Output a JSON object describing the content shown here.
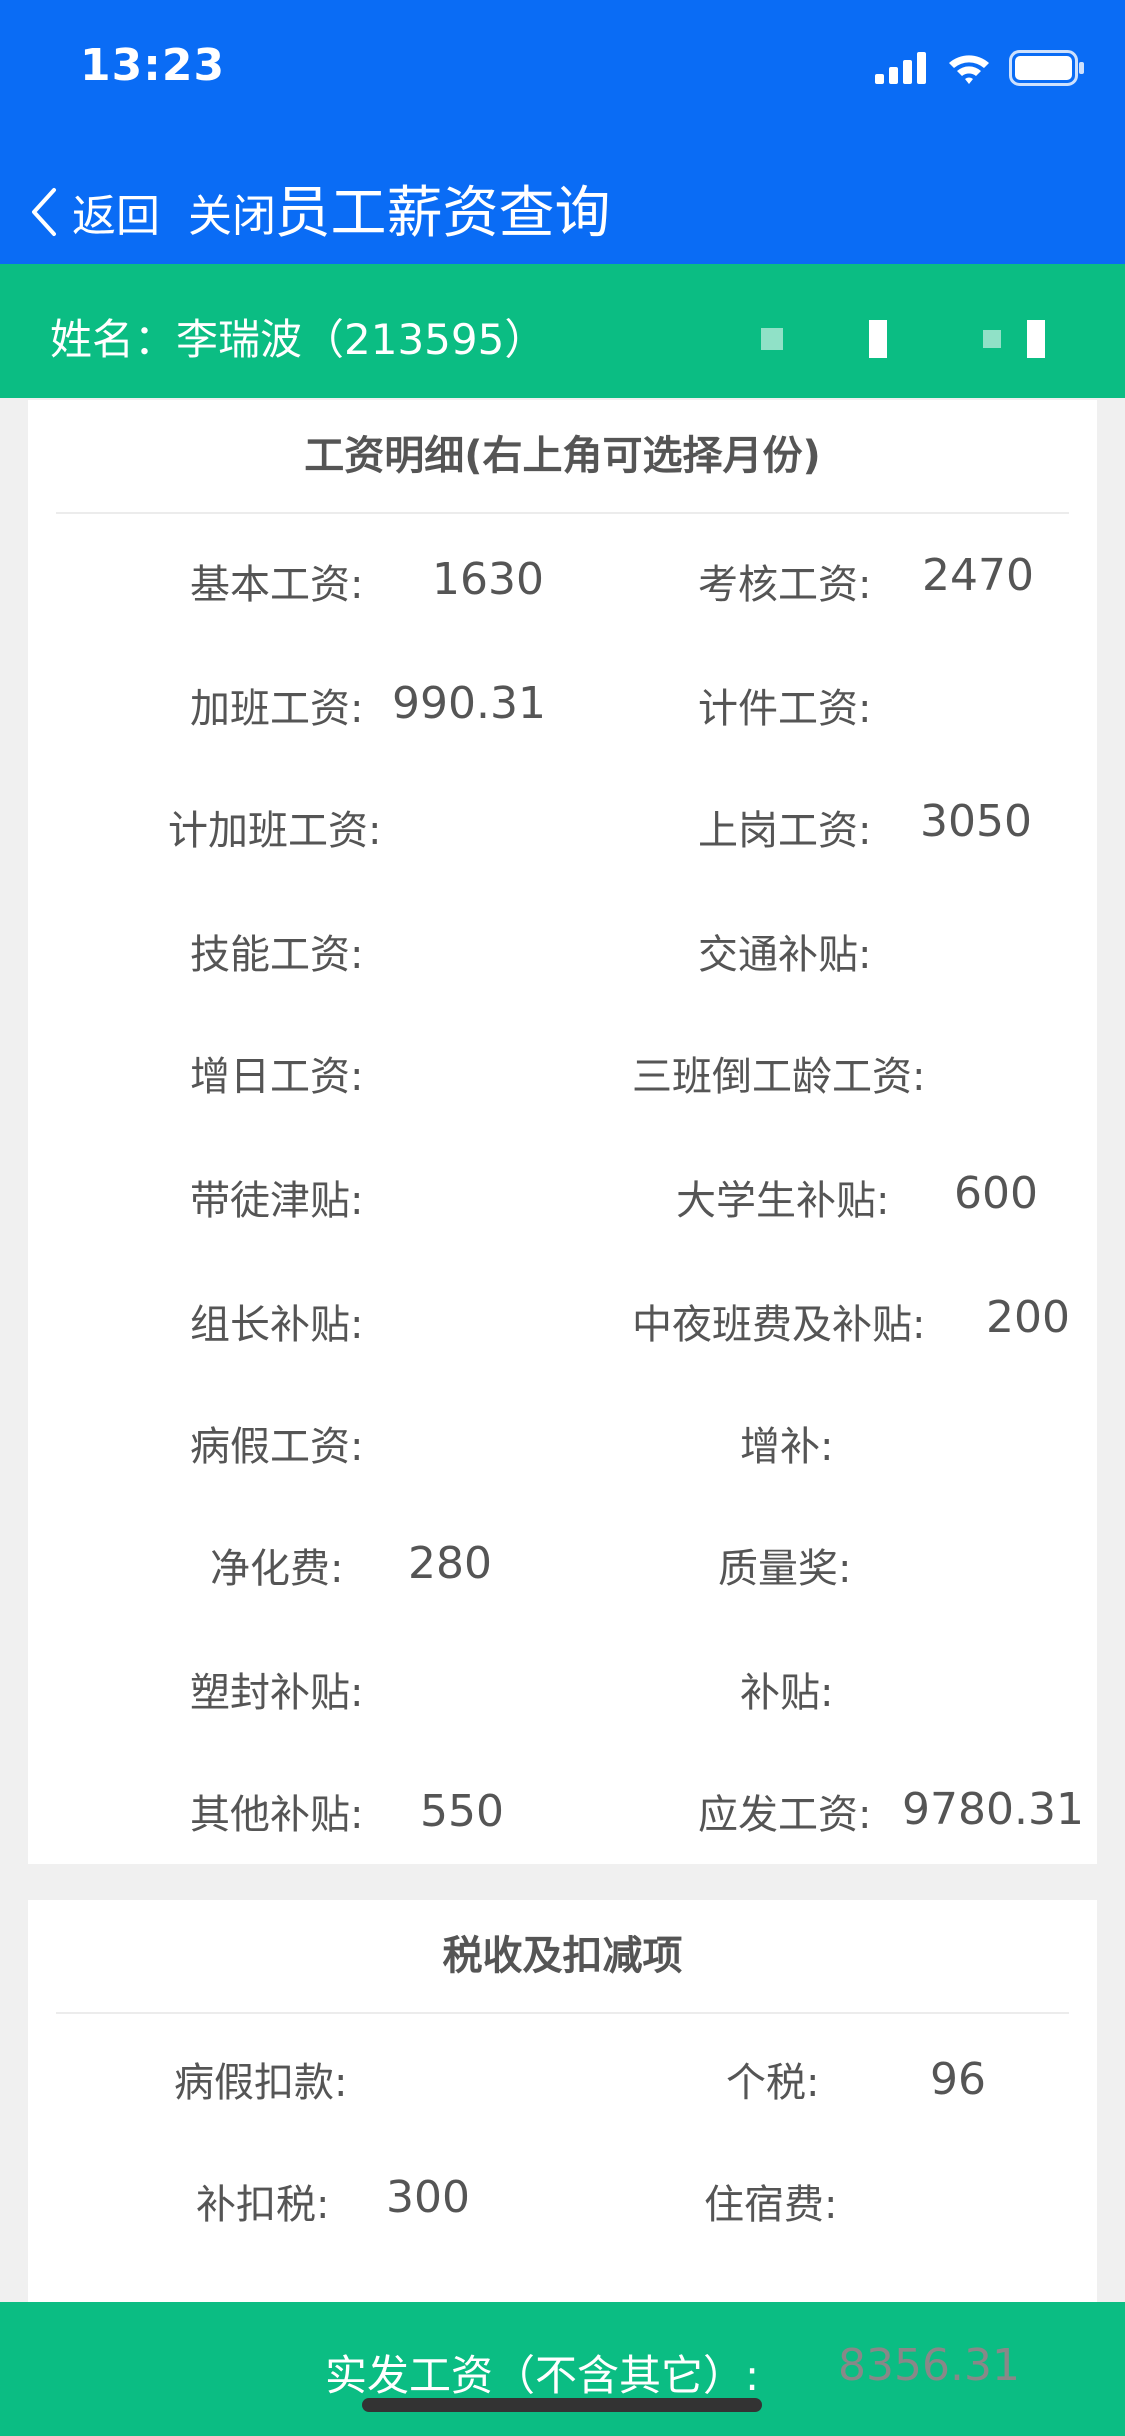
{
  "status": {
    "time": "13:23"
  },
  "nav": {
    "back_label": "返回",
    "close_label": "关闭",
    "title": "员工薪资查询"
  },
  "employee": {
    "name_line": "姓名：李瑞波（213595）"
  },
  "salary_section": {
    "title": "工资明细(右上角可选择月份)",
    "items": [
      {
        "label": "基本工资:",
        "value": "1630"
      },
      {
        "label": "考核工资:",
        "value": "2470"
      },
      {
        "label": "加班工资:",
        "value": "990.31"
      },
      {
        "label": "计件工资:",
        "value": ""
      },
      {
        "label": "计加班工资:",
        "value": ""
      },
      {
        "label": "上岗工资:",
        "value": "3050"
      },
      {
        "label": "技能工资:",
        "value": ""
      },
      {
        "label": "交通补贴:",
        "value": ""
      },
      {
        "label": "增日工资:",
        "value": ""
      },
      {
        "label": "三班倒工龄工资:",
        "value": ""
      },
      {
        "label": "带徒津贴:",
        "value": ""
      },
      {
        "label": "大学生补贴:",
        "value": "600"
      },
      {
        "label": "组长补贴:",
        "value": ""
      },
      {
        "label": "中夜班费及补贴:",
        "value": "200"
      },
      {
        "label": "病假工资:",
        "value": ""
      },
      {
        "label": "增补:",
        "value": ""
      },
      {
        "label": "净化费:",
        "value": "280"
      },
      {
        "label": "质量奖:",
        "value": ""
      },
      {
        "label": "塑封补贴:",
        "value": ""
      },
      {
        "label": "补贴:",
        "value": ""
      },
      {
        "label": "其他补贴:",
        "value": "550"
      },
      {
        "label": "应发工资:",
        "value": "9780.31"
      }
    ]
  },
  "tax_section": {
    "title": "税收及扣减项",
    "items": [
      {
        "label": "病假扣款:",
        "value": ""
      },
      {
        "label": "个税:",
        "value": "96"
      },
      {
        "label": "补扣税:",
        "value": "300"
      },
      {
        "label": "住宿费:",
        "value": ""
      }
    ]
  },
  "net_pay": {
    "label": "实发工资（不含其它）:",
    "value": "8356.31"
  },
  "icons": [
    "back-chevron-icon",
    "signal-icon",
    "wifi-icon",
    "battery-icon"
  ],
  "colors": {
    "nav_blue": "#0a6cf5",
    "accent_green": "#0bbd83",
    "text_gray": "#555555"
  }
}
